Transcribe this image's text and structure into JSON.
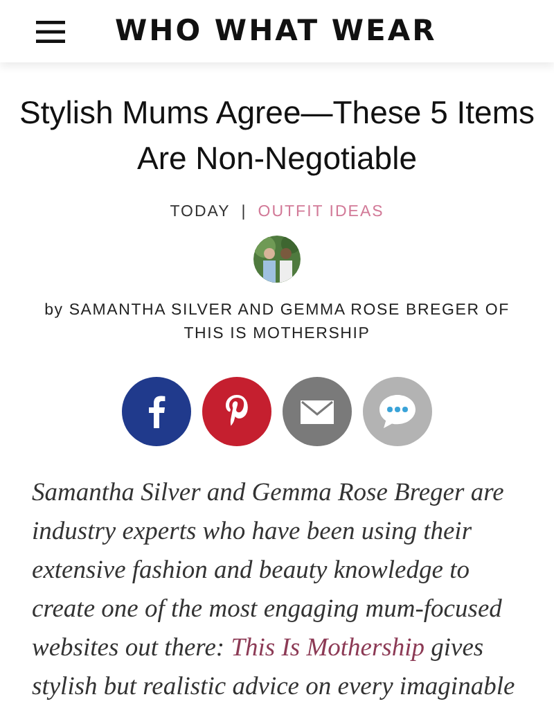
{
  "header": {
    "logo": "WHO WHAT WEAR"
  },
  "article": {
    "title": "Stylish Mums Agree—These 5 Items Are Non-Negotiable",
    "date": "TODAY",
    "separator": "|",
    "category": "OUTFIT IDEAS",
    "byline": "by SAMANTHA SILVER AND GEMMA ROSE BREGER OF THIS IS MOTHERSHIP",
    "share": [
      {
        "kind": "facebook",
        "color": "#203a8c"
      },
      {
        "kind": "pinterest",
        "color": "#c51f2f"
      },
      {
        "kind": "email",
        "color": "#7a7a7a"
      },
      {
        "kind": "comment",
        "color": "#b3b3b3"
      }
    ],
    "intro": {
      "before": "Samantha Silver and Gemma Rose Breger are industry experts who have been using their extensive fashion and beauty knowledge to create one of the most engaging mum-focused websites out there: ",
      "link": "This Is Mothership",
      "after": " gives stylish but realistic advice on every imaginable"
    }
  }
}
